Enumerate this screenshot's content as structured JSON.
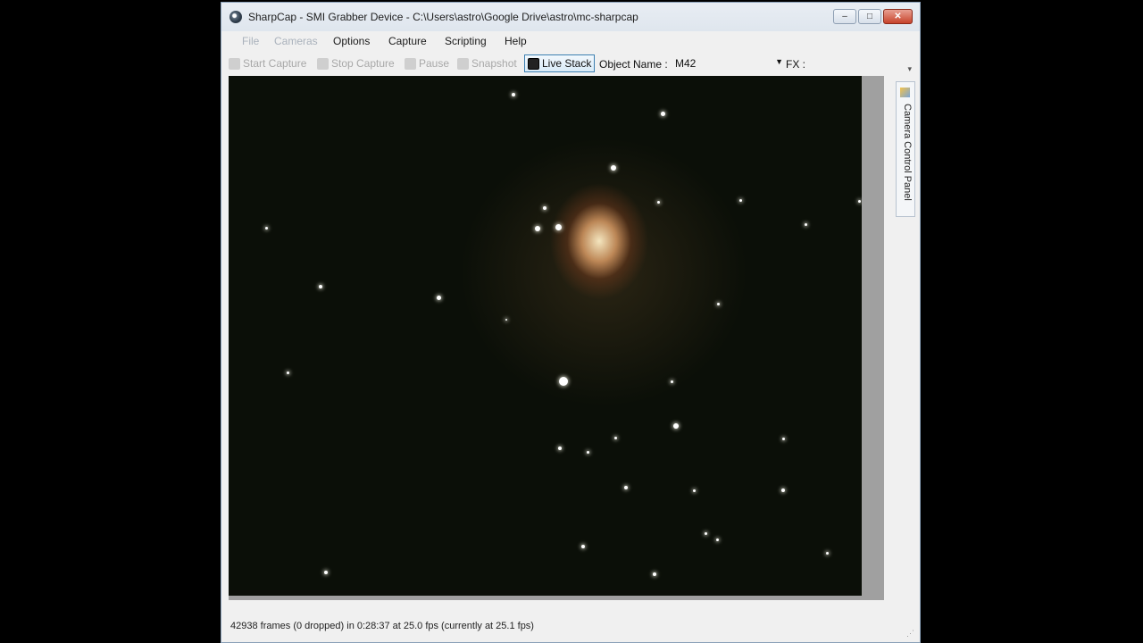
{
  "window": {
    "title": "SharpCap - SMI Grabber Device - C:\\Users\\astro\\Google Drive\\astro\\mc-sharpcap",
    "controls": {
      "minimize": "–",
      "maximize": "□",
      "close": "✕"
    }
  },
  "menu": {
    "file": "File",
    "cameras": "Cameras",
    "options": "Options",
    "capture": "Capture",
    "scripting": "Scripting",
    "help": "Help"
  },
  "toolbar": {
    "start_capture": "Start Capture",
    "stop_capture": "Stop Capture",
    "pause": "Pause",
    "snapshot": "Snapshot",
    "live_stack": "Live Stack",
    "object_name_label": "Object Name :",
    "object_name_value": "M42",
    "fx_label": "FX :"
  },
  "side_panel": {
    "label": "Camera Control Panel"
  },
  "status": {
    "text": "42938 frames (0 dropped) in 0:28:37 at 25.0 fps  (currently at 25.1 fps)"
  },
  "image": {
    "subject": "M42"
  }
}
